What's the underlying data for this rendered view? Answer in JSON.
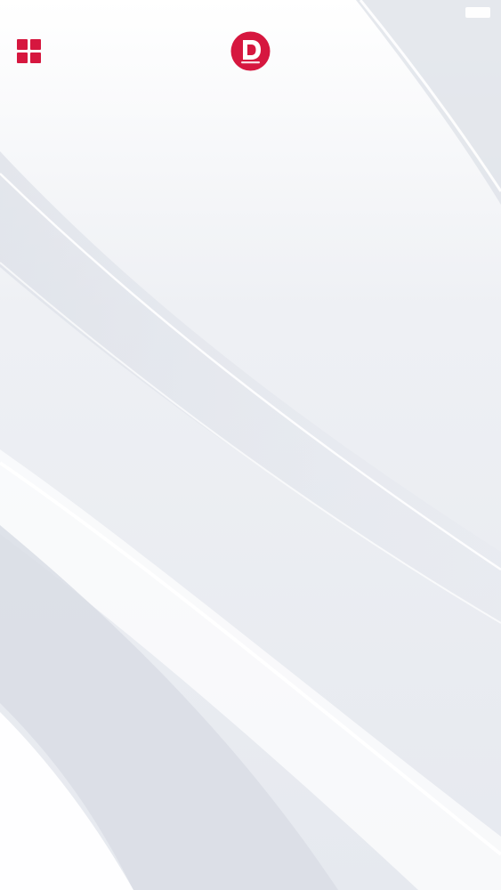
{
  "app": {
    "logo_icon": "app-logo-d",
    "brand_color": "#d6173f"
  },
  "header": {
    "menu_icon": "grid-menu-icon",
    "status_icon": "battery-icon"
  },
  "background": {
    "style": "white-silver-waves",
    "colors": [
      "#f7f8fa",
      "#e2e5ec",
      "#ffffff"
    ]
  }
}
